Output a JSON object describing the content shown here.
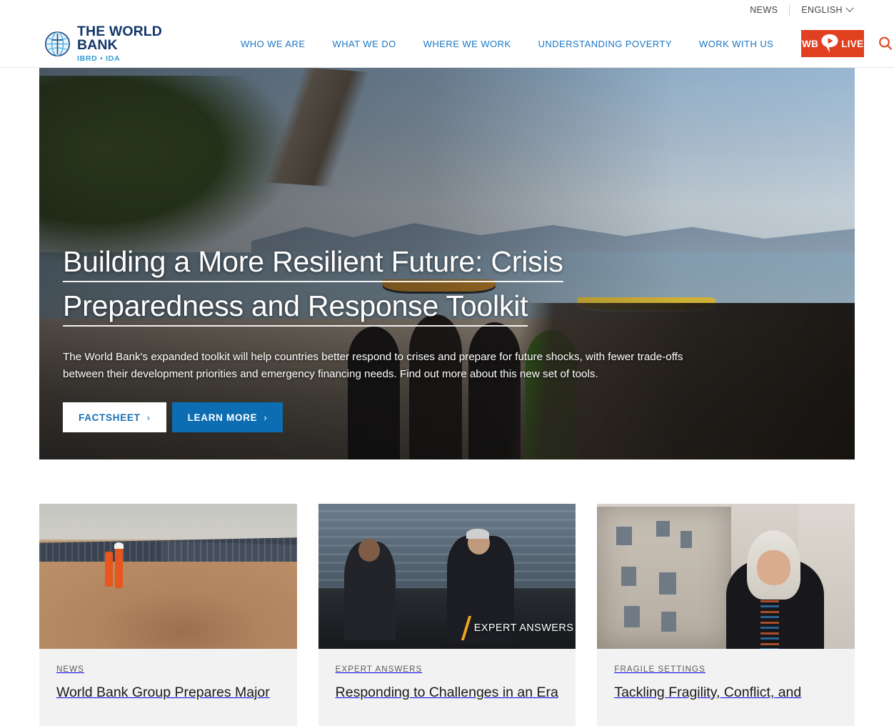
{
  "utility": {
    "news_label": "NEWS",
    "language_label": "ENGLISH",
    "chevron_icon": "chevron-down-icon"
  },
  "header": {
    "logo": {
      "title": "THE WORLD BANK",
      "subtitle": "IBRD • IDA",
      "icon": "globe-icon"
    },
    "nav": [
      {
        "label": "WHO WE ARE"
      },
      {
        "label": "WHAT WE DO"
      },
      {
        "label": "WHERE WE WORK"
      },
      {
        "label": "UNDERSTANDING POVERTY"
      },
      {
        "label": "WORK WITH US"
      }
    ],
    "live_button": {
      "text_before": "WB",
      "text_after": "LIVE",
      "icon": "play-bubble-icon",
      "background": "#e0401f"
    },
    "search": {
      "icon": "search-icon",
      "color": "#e0451f"
    }
  },
  "hero": {
    "title_line1": "Building a More Resilient Future: Crisis",
    "title_line2": "Preparedness and Response Toolkit",
    "description": "The World Bank's expanded toolkit will help countries better respond to crises and prepare for future shocks, with fewer trade-offs between their development priorities and emergency financing needs. Find out more about this new set of tools.",
    "buttons": [
      {
        "label": "FACTSHEET",
        "arrow": "›",
        "style": "light"
      },
      {
        "label": "LEARN MORE",
        "arrow": "›",
        "style": "blue"
      }
    ],
    "image_alt": "Coastal beach scene with moored boats and children looking out to sea"
  },
  "cards": [
    {
      "kicker": "NEWS",
      "title": "World Bank Group Prepares Major",
      "image_alt": "Two workers in orange uniforms standing in front of a large solar panel farm"
    },
    {
      "kicker": "EXPERT ANSWERS",
      "title": "Responding to Challenges in an Era",
      "image_alt": "Two people in conversation on a stage with a flood backdrop",
      "overlay_text": "EXPERT ANSWERS"
    },
    {
      "kicker": "FRAGILE SETTINGS",
      "title": "Tackling Fragility, Conflict, and",
      "image_alt": "Woman wearing a patterned headscarf in front of damaged buildings"
    }
  ],
  "colors": {
    "brand_blue": "#1b77c4",
    "logo_navy": "#12366b",
    "logo_cyan": "#2e9bd6",
    "accent_red": "#e0401f",
    "cta_blue": "#0d6db3",
    "card_bg": "#f2f2f2"
  }
}
